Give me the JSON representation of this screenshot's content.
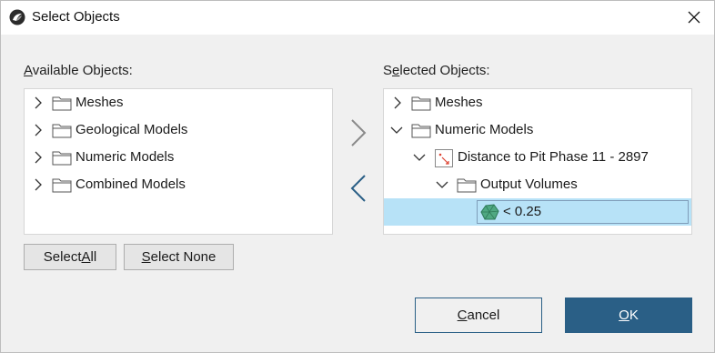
{
  "window": {
    "title": "Select Objects"
  },
  "available": {
    "label_prefix": "",
    "label_accel": "A",
    "label_rest": "vailable Objects:",
    "items": [
      {
        "label": "Meshes"
      },
      {
        "label": "Geological Models"
      },
      {
        "label": "Numeric Models"
      },
      {
        "label": "Combined Models"
      }
    ]
  },
  "selected": {
    "label_prefix": "S",
    "label_accel": "e",
    "label_rest": "lected Objects:",
    "items": [
      {
        "label": "Meshes",
        "expanded": false
      },
      {
        "label": "Numeric Models",
        "expanded": true
      },
      {
        "label": "Distance to Pit Phase 11 - 2897",
        "expanded": true
      },
      {
        "label": "Output Volumes",
        "expanded": true
      },
      {
        "label": "< 0.25",
        "selected": true
      }
    ]
  },
  "buttons": {
    "select_all_prefix": "Select ",
    "select_all_accel": "A",
    "select_all_rest": "ll",
    "select_none_prefix": "",
    "select_none_accel": "S",
    "select_none_rest": "elect None",
    "cancel_prefix": "",
    "cancel_accel": "C",
    "cancel_rest": "ancel",
    "ok_prefix": "",
    "ok_accel": "O",
    "ok_rest": "K"
  },
  "colors": {
    "accent": "#2a5f86",
    "selection": "#b7e2f7",
    "arrow_add": "#8a8a8a",
    "arrow_remove": "#2a5f86"
  }
}
